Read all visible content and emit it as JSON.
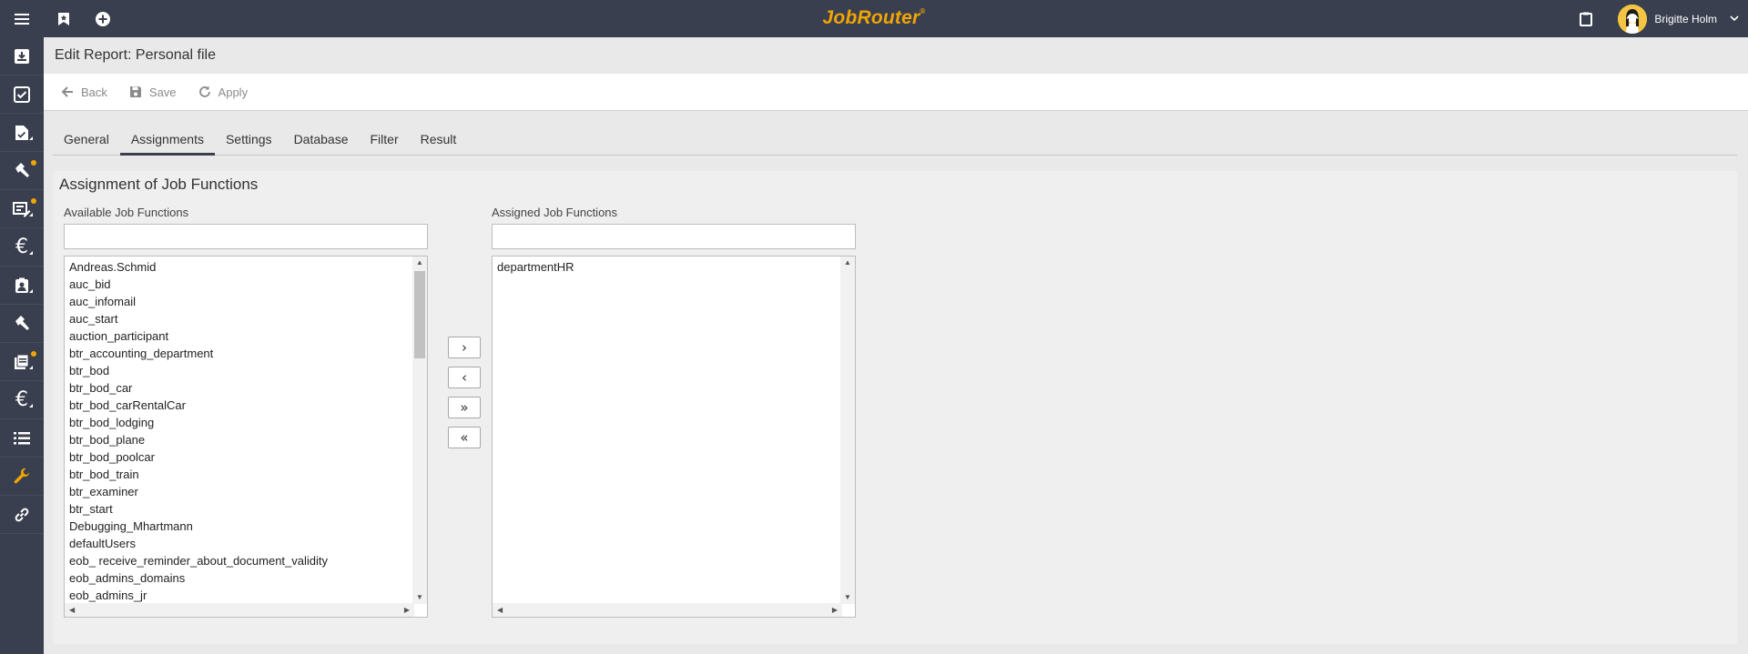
{
  "app": {
    "title": "JobRouter",
    "trademark": "®"
  },
  "topbar": {
    "menu_icon": "hamburger-icon",
    "bookmark_icon": "bookmark-icon",
    "add_icon": "plus-circle-icon",
    "clipboard_icon": "clipboard-icon",
    "user_name": "Brigitte Holm",
    "chevron_icon": "chevron-down-icon"
  },
  "sidebar": {
    "items": [
      {
        "icon": "inbox-icon",
        "badge": false
      },
      {
        "icon": "task-check-icon",
        "badge": false
      },
      {
        "icon": "document-check-icon",
        "badge": false
      },
      {
        "icon": "hammer-icon",
        "badge": true
      },
      {
        "icon": "form-edit-icon",
        "badge": true
      },
      {
        "icon": "euro-icon",
        "badge": false
      },
      {
        "icon": "id-badge-icon",
        "badge": false
      },
      {
        "icon": "hammer-icon",
        "badge": false
      },
      {
        "icon": "documents-icon",
        "badge": true
      },
      {
        "icon": "euro-icon",
        "badge": false
      },
      {
        "icon": "list-icon",
        "badge": false
      },
      {
        "icon": "wrench-icon",
        "badge": false
      },
      {
        "icon": "link-icon",
        "badge": false
      }
    ]
  },
  "page": {
    "title": "Edit Report: Personal file"
  },
  "toolbar": {
    "back_label": "Back",
    "save_label": "Save",
    "apply_label": "Apply"
  },
  "tabs": [
    {
      "label": "General",
      "active": false
    },
    {
      "label": "Assignments",
      "active": true
    },
    {
      "label": "Settings",
      "active": false
    },
    {
      "label": "Database",
      "active": false
    },
    {
      "label": "Filter",
      "active": false
    },
    {
      "label": "Result",
      "active": false
    }
  ],
  "assignment": {
    "title": "Assignment of Job Functions",
    "available_label": "Available Job Functions",
    "assigned_label": "Assigned Job Functions",
    "available_filter_value": "",
    "assigned_filter_value": "",
    "available_items": [
      "Andreas.Schmid",
      "auc_bid",
      "auc_infomail",
      "auc_start",
      "auction_participant",
      "btr_accounting_department",
      "btr_bod",
      "btr_bod_car",
      "btr_bod_carRentalCar",
      "btr_bod_lodging",
      "btr_bod_plane",
      "btr_bod_poolcar",
      "btr_bod_train",
      "btr_examiner",
      "btr_start",
      "Debugging_Mhartmann",
      "defaultUsers",
      "eob_ receive_reminder_about_document_validity",
      "eob_admins_domains",
      "eob_admins_jr"
    ],
    "assigned_items": [
      "departmentHR"
    ],
    "buttons": {
      "move_right": "›",
      "move_left": "‹",
      "move_all_right": "»",
      "move_all_left": "«"
    }
  }
}
